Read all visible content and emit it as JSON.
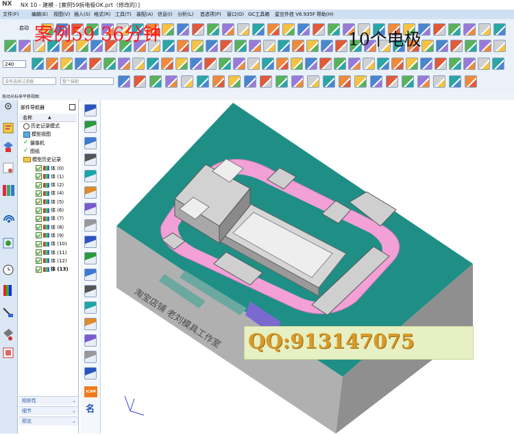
{
  "window": {
    "logo": "NX",
    "title": "NX 10 - 建模 - [案例59拆电极OK.prt（修改的）]"
  },
  "menu": [
    "文件(F)",
    "编辑(E)",
    "视图(V)",
    "插入(S)",
    "格式(R)",
    "工具(T)",
    "装配(A)",
    "信息(I)",
    "分析(L)",
    "首选项(P)",
    "窗口(O)",
    "GC工具箱",
    "星空外挂 V6.935F",
    "帮助(H)"
  ],
  "toolbar": {
    "start_label": "启动",
    "size_value": "240",
    "filter_placeholder": "没有选择过滤器",
    "assembly_placeholder": "整个装配"
  },
  "overlay": {
    "title": "案例59   36分钟",
    "electrodes": "10个电极",
    "qq": "QQ:913147075"
  },
  "hint": "拖动光标来平移视图",
  "navigator": {
    "title": "部件导航器",
    "column": "名称",
    "items": [
      {
        "label": "历史记录模式",
        "kind": "clock",
        "indent": 1
      },
      {
        "label": "模型视图",
        "kind": "view",
        "indent": 1
      },
      {
        "label": "摄像机",
        "kind": "camera",
        "indent": 1
      },
      {
        "label": "图纸",
        "kind": "drawing",
        "indent": 1
      },
      {
        "label": "模型历史记录",
        "kind": "folder",
        "indent": 1
      },
      {
        "label": "体 (0)",
        "kind": "body",
        "indent": 2
      },
      {
        "label": "体 (1)",
        "kind": "body",
        "indent": 2
      },
      {
        "label": "体 (2)",
        "kind": "body",
        "indent": 2
      },
      {
        "label": "体 (4)",
        "kind": "body",
        "indent": 2
      },
      {
        "label": "体 (5)",
        "kind": "body",
        "indent": 2
      },
      {
        "label": "体 (6)",
        "kind": "body",
        "indent": 2
      },
      {
        "label": "体 (7)",
        "kind": "body",
        "indent": 2
      },
      {
        "label": "体 (8)",
        "kind": "body",
        "indent": 2
      },
      {
        "label": "体 (9)",
        "kind": "body",
        "indent": 2
      },
      {
        "label": "体 (10)",
        "kind": "body",
        "indent": 2
      },
      {
        "label": "体 (11)",
        "kind": "body",
        "indent": 2
      },
      {
        "label": "体 (12)",
        "kind": "body",
        "indent": 2
      },
      {
        "label": "体 (13)",
        "kind": "body",
        "indent": 2,
        "bold": true
      }
    ],
    "footer": [
      "相依性",
      "细节",
      "预览"
    ]
  },
  "part": {
    "engraving": "淘宝店铺  老刘模具工作室"
  },
  "tools": {
    "icam_label": "ICAM",
    "name_label": "名"
  },
  "colors": {
    "top_face": "#1f8f86",
    "side_face": "#a9a9a9",
    "pocket": "#f2a0d6",
    "electrode": "#c9c9c9",
    "menubar": "#cfe0f3",
    "overlay_red": "#ff1a1a",
    "qq_text": "#d89a2a"
  }
}
